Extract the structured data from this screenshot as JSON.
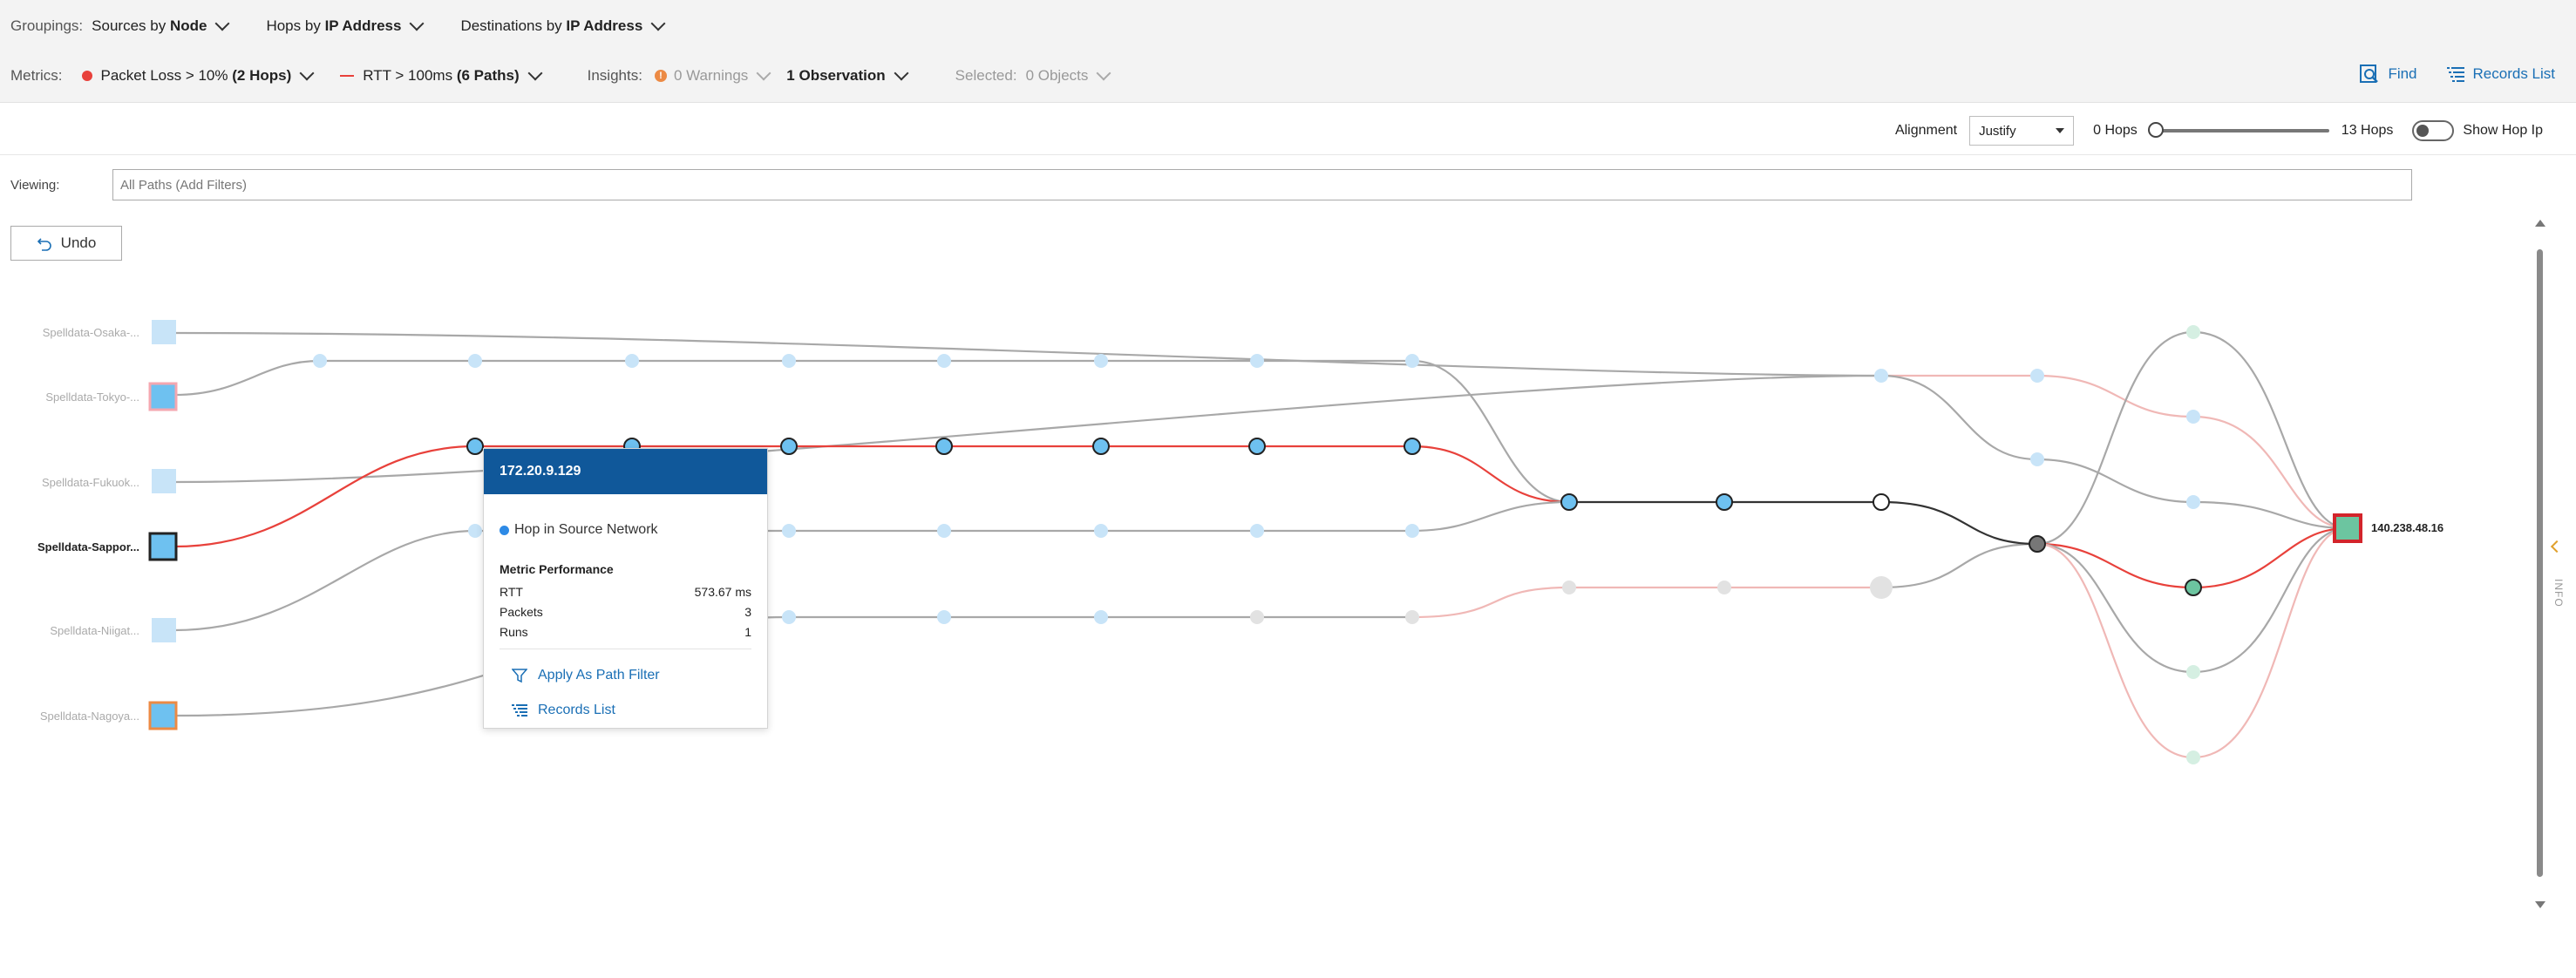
{
  "groupings": {
    "label": "Groupings:",
    "sources": {
      "prefix": "Sources by",
      "value": "Node"
    },
    "hops": {
      "prefix": "Hops by",
      "value": "IP Address"
    },
    "destinations": {
      "prefix": "Destinations by",
      "value": "IP Address"
    }
  },
  "metrics": {
    "label": "Metrics:",
    "packet_loss": {
      "prefix": "Packet Loss > 10%",
      "value": "(2 Hops)"
    },
    "rtt": {
      "prefix": "RTT > 100ms",
      "value": "(6 Paths)"
    }
  },
  "insights": {
    "label": "Insights:",
    "warnings": "0 Warnings",
    "warn_badge": "!",
    "observation": "1 Observation"
  },
  "selected": {
    "label": "Selected:",
    "value": "0 Objects"
  },
  "actions": {
    "find": "Find",
    "records_list": "Records List"
  },
  "alignment": {
    "label": "Alignment",
    "value": "Justify",
    "hops_min": "0 Hops",
    "hops_max": "13 Hops",
    "show_hop_ip": "Show Hop Ip"
  },
  "viewing": {
    "label": "Viewing:",
    "placeholder": "All Paths (Add Filters)"
  },
  "undo": "Undo",
  "sources": [
    {
      "label": "Spelldata-Osaka-..."
    },
    {
      "label": "Spelldata-Tokyo-..."
    },
    {
      "label": "Spelldata-Fukuok..."
    },
    {
      "label": "Spelldata-Sappor..."
    },
    {
      "label": "Spelldata-Niigat..."
    },
    {
      "label": "Spelldata-Nagoya..."
    }
  ],
  "destination": "140.238.48.16",
  "popup": {
    "title": "172.20.9.129",
    "hop_type": "Hop in Source Network",
    "section": "Metric Performance",
    "rtt_label": "RTT",
    "rtt_value": "573.67 ms",
    "packets_label": "Packets",
    "packets_value": "3",
    "runs_label": "Runs",
    "runs_value": "1",
    "apply_filter": "Apply As Path Filter",
    "records_list": "Records List"
  },
  "info_tab": "INFO",
  "colors": {
    "header_blue": "#10589a",
    "link_blue": "#1a6fb5",
    "alert_red": "#e8413b",
    "warning_orange": "#ec8a44",
    "hop_blue": "#6ec1f0",
    "dest_green": "#6cc5a0"
  }
}
